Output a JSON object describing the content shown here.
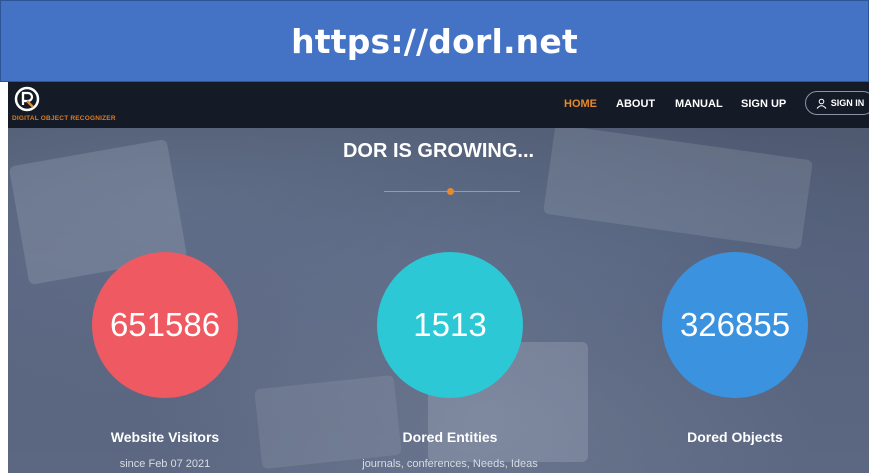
{
  "banner": {
    "url": "https://dorl.net"
  },
  "navbar": {
    "logo_text": "DIGITAL OBJECT RECOGNIZER",
    "items": [
      {
        "label": "HOME",
        "active": true
      },
      {
        "label": "ABOUT",
        "active": false
      },
      {
        "label": "MANUAL",
        "active": false
      },
      {
        "label": "SIGN UP",
        "active": false
      }
    ],
    "signin_label": "SIGN IN"
  },
  "section": {
    "title": "DOR IS GROWING..."
  },
  "stats": [
    {
      "value": "651586",
      "label": "Website Visitors",
      "sub": "since Feb 07 2021",
      "color": "#ef5a62"
    },
    {
      "value": "1513",
      "label": "Dored Entities",
      "sub": "journals, conferences, Needs, Ideas",
      "color": "#2cc8d6"
    },
    {
      "value": "326855",
      "label": "Dored Objects",
      "sub": "",
      "color": "#3b93e0"
    }
  ],
  "colors": {
    "accent": "#e8892b",
    "navbar": "#141b26",
    "banner": "#4472c4"
  }
}
